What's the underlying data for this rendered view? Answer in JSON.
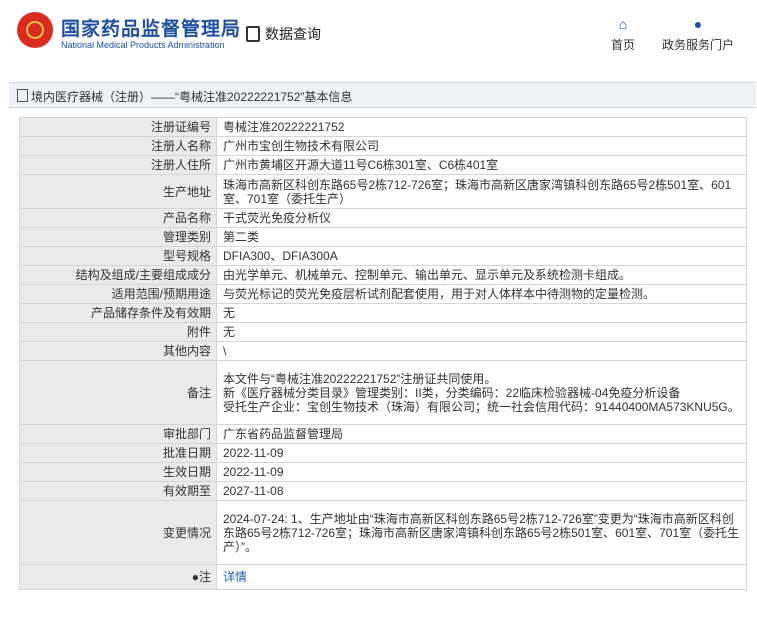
{
  "header": {
    "org_cn": "国家药品监督管理局",
    "org_en": "National Medical Products Administration",
    "query_label": "数据查询",
    "nav_home": "首页",
    "nav_portal": "政务服务门户"
  },
  "breadcrumb": "境内医疗器械（注册）——“粤械注准20222221752”基本信息",
  "rows": [
    {
      "label": "注册证编号",
      "value": "粤械注准20222221752"
    },
    {
      "label": "注册人名称",
      "value": "广州市宝创生物技术有限公司"
    },
    {
      "label": "注册人住所",
      "value": "广州市黄埔区开源大道11号C6栋301室、C6栋401室"
    },
    {
      "label": "生产地址",
      "value": "珠海市高新区科创东路65号2栋712-726室；珠海市高新区唐家湾镇科创东路65号2栋501室、601室、701室（委托生产）"
    },
    {
      "label": "产品名称",
      "value": "干式荧光免疫分析仪"
    },
    {
      "label": "管理类别",
      "value": "第二类"
    },
    {
      "label": "型号规格",
      "value": "DFIA300、DFIA300A"
    },
    {
      "label": "结构及组成/主要组成成分",
      "value": "由光学单元、机械单元、控制单元、输出单元、显示单元及系统检测卡组成。"
    },
    {
      "label": "适用范围/预期用途",
      "value": "与荧光标记的荧光免疫层析试剂配套使用，用于对人体样本中待测物的定量检测。"
    },
    {
      "label": "产品储存条件及有效期",
      "value": "无"
    },
    {
      "label": "附件",
      "value": "无"
    },
    {
      "label": "其他内容",
      "value": "\\"
    },
    {
      "label": "备注",
      "value_lines": [
        "本文件与“粤械注准20222221752”注册证共同使用。",
        "新《医疗器械分类目录》管理类别：II类，分类编码：22临床检验器械-04免疫分析设备",
        "受托生产企业：宝创生物技术（珠海）有限公司；统一社会信用代码：91440400MA573KNU5G。"
      ]
    },
    {
      "label": "审批部门",
      "value": "广东省药品监督管理局"
    },
    {
      "label": "批准日期",
      "value": "2022-11-09"
    },
    {
      "label": "生效日期",
      "value": "2022-11-09"
    },
    {
      "label": "有效期至",
      "value": "2027-11-08"
    },
    {
      "label": "变更情况",
      "value": "2024-07-24: 1、生产地址由“珠海市高新区科创东路65号2栋712-726室”变更为“珠海市高新区科创东路65号2栋712-726室；珠海市高新区唐家湾镇科创东路65号2栋501室、601室、701室（委托生产）”。"
    },
    {
      "label": "注",
      "value": "详情"
    }
  ]
}
